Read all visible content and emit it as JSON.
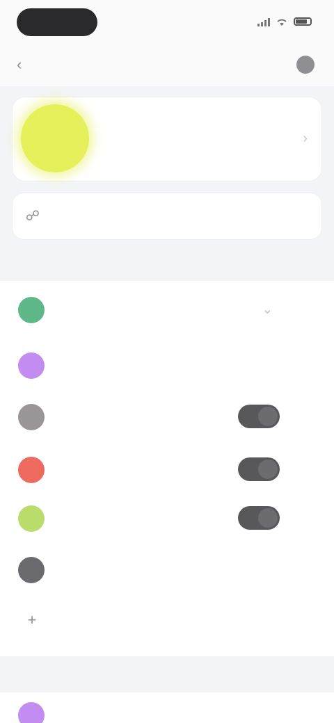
{
  "status_bar": {
    "time": "",
    "icons": [
      "signal-icon",
      "wifi-icon",
      "battery-icon"
    ]
  },
  "nav": {
    "title": "",
    "back_icon": "chevron-left-icon",
    "right_icon": "avatar-icon"
  },
  "profile": {
    "name": "",
    "avatar_color": "#e6f05a"
  },
  "action": {
    "label": "",
    "icon": "link-icon"
  },
  "sections": [
    {
      "title": ""
    },
    {
      "title": ""
    }
  ],
  "rows": [
    {
      "title": "",
      "subtitle": "",
      "icon_color": "#5fb88a",
      "control": "chevron"
    },
    {
      "title": "",
      "subtitle": "",
      "icon_color": "#c28cf0",
      "control": "none"
    },
    {
      "title": "",
      "subtitle": "",
      "icon_color": "#9a9596",
      "control": "toggle"
    },
    {
      "title": "",
      "subtitle": "",
      "icon_color": "#ee6a5f",
      "control": "toggle"
    },
    {
      "title": "",
      "subtitle": "",
      "icon_color": "#b9dc6b",
      "control": "toggle"
    },
    {
      "title": "",
      "subtitle": "",
      "icon_color": "#6b6b6f",
      "control": "none"
    },
    {
      "title": "",
      "subtitle": "",
      "icon_color": "",
      "control": "add"
    }
  ],
  "bottom_row": {
    "title": "",
    "icon_color": "#c28cf0"
  }
}
